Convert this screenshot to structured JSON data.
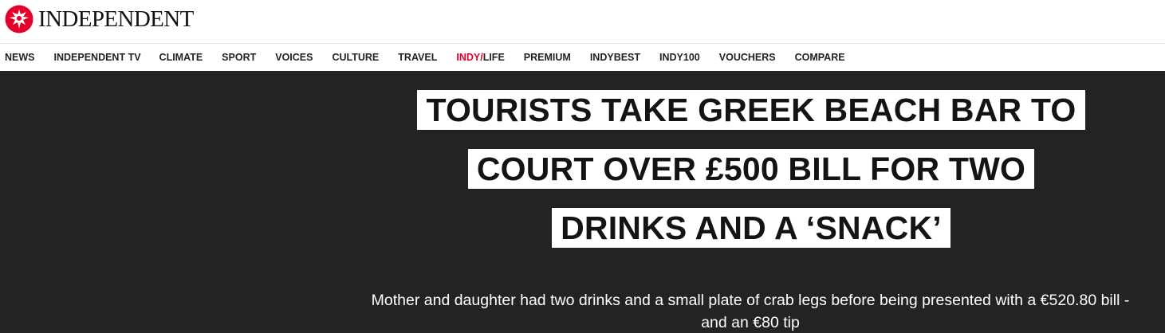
{
  "header": {
    "logo_text": "INDEPENDENT"
  },
  "nav": {
    "items": [
      {
        "label": "NEWS"
      },
      {
        "label": "INDEPENDENT TV"
      },
      {
        "label": "CLIMATE"
      },
      {
        "label": "SPORT"
      },
      {
        "label": "VOICES"
      },
      {
        "label": "CULTURE"
      },
      {
        "label": "TRAVEL"
      },
      {
        "label_prefix": "INDY/",
        "label_suffix": "LIFE"
      },
      {
        "label": "PREMIUM"
      },
      {
        "label": "INDYBEST"
      },
      {
        "label": "INDY100"
      },
      {
        "label": "VOUCHERS"
      },
      {
        "label": "COMPARE"
      }
    ]
  },
  "article": {
    "headline_lines": [
      "TOURISTS TAKE GREEK BEACH BAR TO",
      "COURT OVER £500 BILL FOR TWO",
      "DRINKS AND A ‘SNACK’"
    ],
    "standfirst": "Mother and daughter had two drinks and a small plate of crab legs before being presented with a €520.80 bill - and an €80 tip"
  },
  "colors": {
    "brand_red": "#e4002b",
    "hero_background": "#232323",
    "headline_highlight": "#ffffff"
  },
  "icons": {
    "logo": "eagle-logo-icon"
  }
}
